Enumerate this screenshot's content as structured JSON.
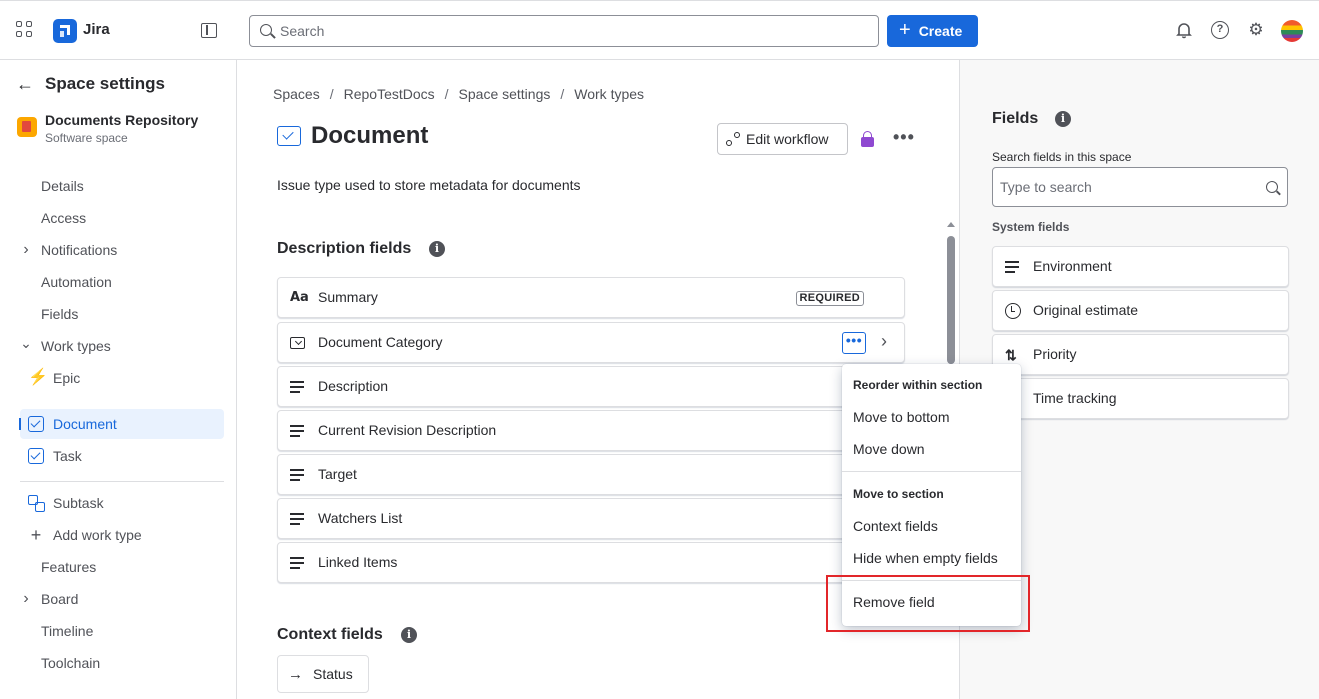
{
  "app": {
    "name": "Jira"
  },
  "topbar": {
    "search_placeholder": "Search",
    "create_label": "Create",
    "create_plus": "+",
    "notifications_icon": "bell-icon",
    "help_icon": "help-icon",
    "help_glyph": "?",
    "settings_icon": "gear-icon",
    "settings_glyph": "⚙",
    "bell_glyph": "🔔"
  },
  "sidebar": {
    "title": "Space settings",
    "back_glyph": "←",
    "space": {
      "name": "Documents Repository",
      "type": "Software space"
    },
    "items": [
      {
        "label": "Details"
      },
      {
        "label": "Access"
      },
      {
        "label": "Notifications",
        "chevron": "›"
      },
      {
        "label": "Automation"
      },
      {
        "label": "Fields"
      },
      {
        "label": "Work types",
        "chevron": "⌄"
      },
      {
        "label": "Epic",
        "icon": "epic-icon",
        "glyph": "⚡"
      },
      {
        "label": "Document",
        "icon": "document-type-icon",
        "active": true
      },
      {
        "label": "Task",
        "icon": "task-icon"
      },
      {
        "label": "Subtask",
        "icon": "subtask-icon"
      },
      {
        "label": "Add work type",
        "icon": "plus-icon",
        "glyph": "+"
      },
      {
        "label": "Features"
      },
      {
        "label": "Board",
        "chevron": "›"
      },
      {
        "label": "Timeline"
      },
      {
        "label": "Toolchain"
      }
    ]
  },
  "main": {
    "breadcrumb": [
      "Spaces",
      "RepoTestDocs",
      "Space settings",
      "Work types"
    ],
    "breadcrumb_sep": "/",
    "title": "Document",
    "edit_workflow_label": "Edit workflow",
    "more_glyph": "•••",
    "description": "Issue type used to store metadata for documents",
    "description_fields_title": "Description fields",
    "info_glyph": "i",
    "description_fields": [
      {
        "label": "Summary",
        "icon": "text-field-icon",
        "glyph": "Aa",
        "badge": "REQUIRED"
      },
      {
        "label": "Document Category",
        "icon": "select-field-icon",
        "more": "•••",
        "chevron": "›"
      },
      {
        "label": "Description",
        "icon": "paragraph-icon"
      },
      {
        "label": "Current Revision Description",
        "icon": "paragraph-icon"
      },
      {
        "label": "Target",
        "icon": "paragraph-icon"
      },
      {
        "label": "Watchers List",
        "icon": "paragraph-icon"
      },
      {
        "label": "Linked Items",
        "icon": "paragraph-icon"
      }
    ],
    "context_fields_title": "Context fields",
    "context_fields": [
      {
        "label": "Status",
        "glyph": "→"
      }
    ]
  },
  "menu": {
    "section1_heading": "Reorder within section",
    "section1_items": [
      "Move to bottom",
      "Move down"
    ],
    "section2_heading": "Move to section",
    "section2_items": [
      "Context fields",
      "Hide when empty fields"
    ],
    "remove_label": "Remove field",
    "highlight_color": "#E2262A"
  },
  "right_panel": {
    "title": "Fields",
    "search_label": "Search fields in this space",
    "search_placeholder": "Type to search",
    "system_fields_title": "System fields",
    "system_fields": [
      {
        "label": "Environment",
        "icon": "paragraph-icon"
      },
      {
        "label": "Original estimate",
        "icon": "clock-icon"
      },
      {
        "label": "Priority",
        "icon": "priority-sort-icon",
        "glyph": "⇅"
      },
      {
        "label": "Time tracking",
        "icon": "clock-icon"
      }
    ]
  },
  "colors": {
    "brand": "#1868DB",
    "active_bg": "#E9F2FE",
    "lock": "#8F49D1"
  }
}
